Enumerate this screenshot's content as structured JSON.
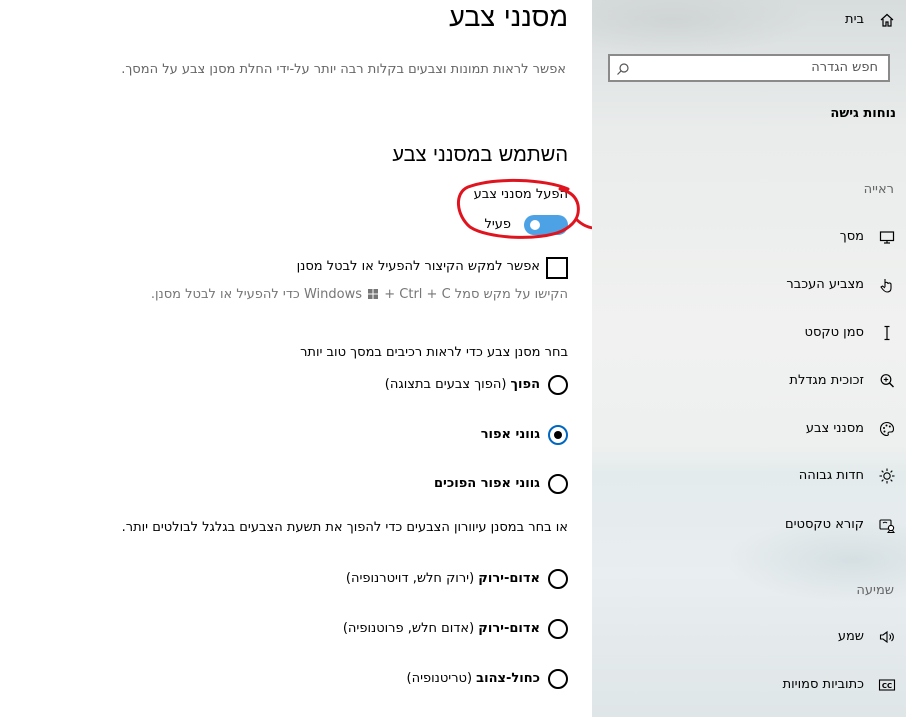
{
  "page": {
    "title": "מסנני צבע",
    "description": "אפשר לראות תמונות וצבעים בקלות רבה יותר על-ידי החלת מסנן צבע על המסך.",
    "section_heading": "השתמש במסנני צבע",
    "toggle_label": "הפעל מסנני צבע",
    "toggle_state": "פעיל",
    "toggle_on": true,
    "shortcut_checkbox_label": "אפשר למקש הקיצור להפעיל או לבטל מסנן",
    "shortcut_checked": false,
    "shortcut_hint": "הקישו על מקש סמל Windows + Ctrl + C כדי להפעיל או לבטל מסנן.",
    "choose_filter_label": "בחר מסנן צבע כדי לראות רכיבים במסך טוב יותר",
    "filters": [
      {
        "bold": "הפוך",
        "rest": " (הפוך צבעים בתצוגה)",
        "selected": false
      },
      {
        "bold": "גווני אפור",
        "rest": "",
        "selected": true
      },
      {
        "bold": "גווני אפור הפוכים",
        "rest": "",
        "selected": false
      }
    ],
    "colorblind_label": "או בחר במסנן עיוורון הצבעים כדי להפוך את תשעת הצבעים בגלגל לבולטים יותר.",
    "colorblind_filters": [
      {
        "bold": "אדום-ירוק",
        "rest": " (ירוק חלש, דויטרנופיה)",
        "selected": false
      },
      {
        "bold": "אדום-ירוק",
        "rest": " (אדום חלש, פרוטנופיה)",
        "selected": false
      },
      {
        "bold": "כחול-צהוב",
        "rest": " (טריטנופיה)",
        "selected": false
      }
    ]
  },
  "sidebar": {
    "home": "בית",
    "search_placeholder": "חפש הגדרה",
    "category": "נוחות גישה",
    "groups": [
      {
        "label": "ראייה",
        "items": [
          {
            "label": "מסך",
            "icon": "monitor-icon"
          },
          {
            "label": "מצביע העכבר",
            "icon": "mouse-pointer-icon"
          },
          {
            "label": "סמן טקסט",
            "icon": "text-cursor-icon"
          },
          {
            "label": "זכוכית מגדלת",
            "icon": "magnifier-icon"
          },
          {
            "label": "מסנני צבע",
            "icon": "palette-icon"
          },
          {
            "label": "חדות גבוהה",
            "icon": "sun-icon"
          },
          {
            "label": "קורא טקסטים",
            "icon": "narrator-icon"
          }
        ]
      },
      {
        "label": "שמיעה",
        "items": [
          {
            "label": "שמע",
            "icon": "speaker-icon"
          },
          {
            "label": "כתוביות סמויות",
            "icon": "cc-icon"
          }
        ]
      }
    ]
  },
  "colors": {
    "accent": "#4da2e6",
    "annotation": "#e0141e"
  }
}
